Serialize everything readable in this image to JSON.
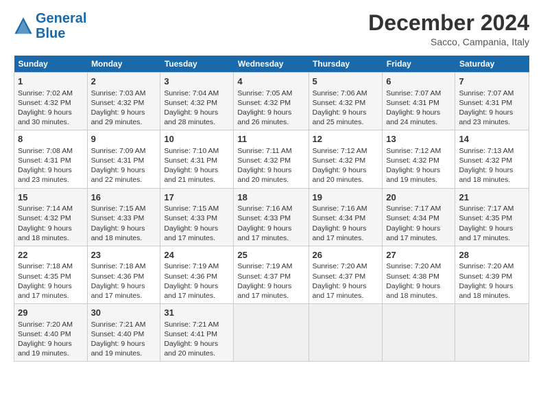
{
  "header": {
    "logo_line1": "General",
    "logo_line2": "Blue",
    "main_title": "December 2024",
    "subtitle": "Sacco, Campania, Italy"
  },
  "days_of_week": [
    "Sunday",
    "Monday",
    "Tuesday",
    "Wednesday",
    "Thursday",
    "Friday",
    "Saturday"
  ],
  "weeks": [
    [
      {
        "num": "1",
        "lines": [
          "Sunrise: 7:02 AM",
          "Sunset: 4:32 PM",
          "Daylight: 9 hours",
          "and 30 minutes."
        ]
      },
      {
        "num": "2",
        "lines": [
          "Sunrise: 7:03 AM",
          "Sunset: 4:32 PM",
          "Daylight: 9 hours",
          "and 29 minutes."
        ]
      },
      {
        "num": "3",
        "lines": [
          "Sunrise: 7:04 AM",
          "Sunset: 4:32 PM",
          "Daylight: 9 hours",
          "and 28 minutes."
        ]
      },
      {
        "num": "4",
        "lines": [
          "Sunrise: 7:05 AM",
          "Sunset: 4:32 PM",
          "Daylight: 9 hours",
          "and 26 minutes."
        ]
      },
      {
        "num": "5",
        "lines": [
          "Sunrise: 7:06 AM",
          "Sunset: 4:32 PM",
          "Daylight: 9 hours",
          "and 25 minutes."
        ]
      },
      {
        "num": "6",
        "lines": [
          "Sunrise: 7:07 AM",
          "Sunset: 4:31 PM",
          "Daylight: 9 hours",
          "and 24 minutes."
        ]
      },
      {
        "num": "7",
        "lines": [
          "Sunrise: 7:07 AM",
          "Sunset: 4:31 PM",
          "Daylight: 9 hours",
          "and 23 minutes."
        ]
      }
    ],
    [
      {
        "num": "8",
        "lines": [
          "Sunrise: 7:08 AM",
          "Sunset: 4:31 PM",
          "Daylight: 9 hours",
          "and 23 minutes."
        ]
      },
      {
        "num": "9",
        "lines": [
          "Sunrise: 7:09 AM",
          "Sunset: 4:31 PM",
          "Daylight: 9 hours",
          "and 22 minutes."
        ]
      },
      {
        "num": "10",
        "lines": [
          "Sunrise: 7:10 AM",
          "Sunset: 4:31 PM",
          "Daylight: 9 hours",
          "and 21 minutes."
        ]
      },
      {
        "num": "11",
        "lines": [
          "Sunrise: 7:11 AM",
          "Sunset: 4:32 PM",
          "Daylight: 9 hours",
          "and 20 minutes."
        ]
      },
      {
        "num": "12",
        "lines": [
          "Sunrise: 7:12 AM",
          "Sunset: 4:32 PM",
          "Daylight: 9 hours",
          "and 20 minutes."
        ]
      },
      {
        "num": "13",
        "lines": [
          "Sunrise: 7:12 AM",
          "Sunset: 4:32 PM",
          "Daylight: 9 hours",
          "and 19 minutes."
        ]
      },
      {
        "num": "14",
        "lines": [
          "Sunrise: 7:13 AM",
          "Sunset: 4:32 PM",
          "Daylight: 9 hours",
          "and 18 minutes."
        ]
      }
    ],
    [
      {
        "num": "15",
        "lines": [
          "Sunrise: 7:14 AM",
          "Sunset: 4:32 PM",
          "Daylight: 9 hours",
          "and 18 minutes."
        ]
      },
      {
        "num": "16",
        "lines": [
          "Sunrise: 7:15 AM",
          "Sunset: 4:33 PM",
          "Daylight: 9 hours",
          "and 18 minutes."
        ]
      },
      {
        "num": "17",
        "lines": [
          "Sunrise: 7:15 AM",
          "Sunset: 4:33 PM",
          "Daylight: 9 hours",
          "and 17 minutes."
        ]
      },
      {
        "num": "18",
        "lines": [
          "Sunrise: 7:16 AM",
          "Sunset: 4:33 PM",
          "Daylight: 9 hours",
          "and 17 minutes."
        ]
      },
      {
        "num": "19",
        "lines": [
          "Sunrise: 7:16 AM",
          "Sunset: 4:34 PM",
          "Daylight: 9 hours",
          "and 17 minutes."
        ]
      },
      {
        "num": "20",
        "lines": [
          "Sunrise: 7:17 AM",
          "Sunset: 4:34 PM",
          "Daylight: 9 hours",
          "and 17 minutes."
        ]
      },
      {
        "num": "21",
        "lines": [
          "Sunrise: 7:17 AM",
          "Sunset: 4:35 PM",
          "Daylight: 9 hours",
          "and 17 minutes."
        ]
      }
    ],
    [
      {
        "num": "22",
        "lines": [
          "Sunrise: 7:18 AM",
          "Sunset: 4:35 PM",
          "Daylight: 9 hours",
          "and 17 minutes."
        ]
      },
      {
        "num": "23",
        "lines": [
          "Sunrise: 7:18 AM",
          "Sunset: 4:36 PM",
          "Daylight: 9 hours",
          "and 17 minutes."
        ]
      },
      {
        "num": "24",
        "lines": [
          "Sunrise: 7:19 AM",
          "Sunset: 4:36 PM",
          "Daylight: 9 hours",
          "and 17 minutes."
        ]
      },
      {
        "num": "25",
        "lines": [
          "Sunrise: 7:19 AM",
          "Sunset: 4:37 PM",
          "Daylight: 9 hours",
          "and 17 minutes."
        ]
      },
      {
        "num": "26",
        "lines": [
          "Sunrise: 7:20 AM",
          "Sunset: 4:37 PM",
          "Daylight: 9 hours",
          "and 17 minutes."
        ]
      },
      {
        "num": "27",
        "lines": [
          "Sunrise: 7:20 AM",
          "Sunset: 4:38 PM",
          "Daylight: 9 hours",
          "and 18 minutes."
        ]
      },
      {
        "num": "28",
        "lines": [
          "Sunrise: 7:20 AM",
          "Sunset: 4:39 PM",
          "Daylight: 9 hours",
          "and 18 minutes."
        ]
      }
    ],
    [
      {
        "num": "29",
        "lines": [
          "Sunrise: 7:20 AM",
          "Sunset: 4:40 PM",
          "Daylight: 9 hours",
          "and 19 minutes."
        ]
      },
      {
        "num": "30",
        "lines": [
          "Sunrise: 7:21 AM",
          "Sunset: 4:40 PM",
          "Daylight: 9 hours",
          "and 19 minutes."
        ]
      },
      {
        "num": "31",
        "lines": [
          "Sunrise: 7:21 AM",
          "Sunset: 4:41 PM",
          "Daylight: 9 hours",
          "and 20 minutes."
        ]
      },
      null,
      null,
      null,
      null
    ]
  ]
}
